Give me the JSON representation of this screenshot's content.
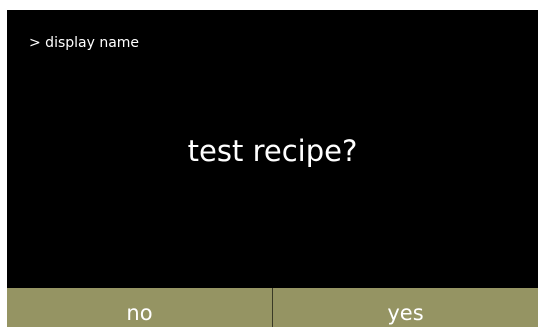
{
  "header": {
    "breadcrumb": "> display name"
  },
  "main": {
    "prompt": "test recipe?"
  },
  "buttons": {
    "no_label": "no",
    "yes_label": "yes"
  },
  "colors": {
    "background": "#000000",
    "text": "#ffffff",
    "button_bar": "#959463"
  }
}
